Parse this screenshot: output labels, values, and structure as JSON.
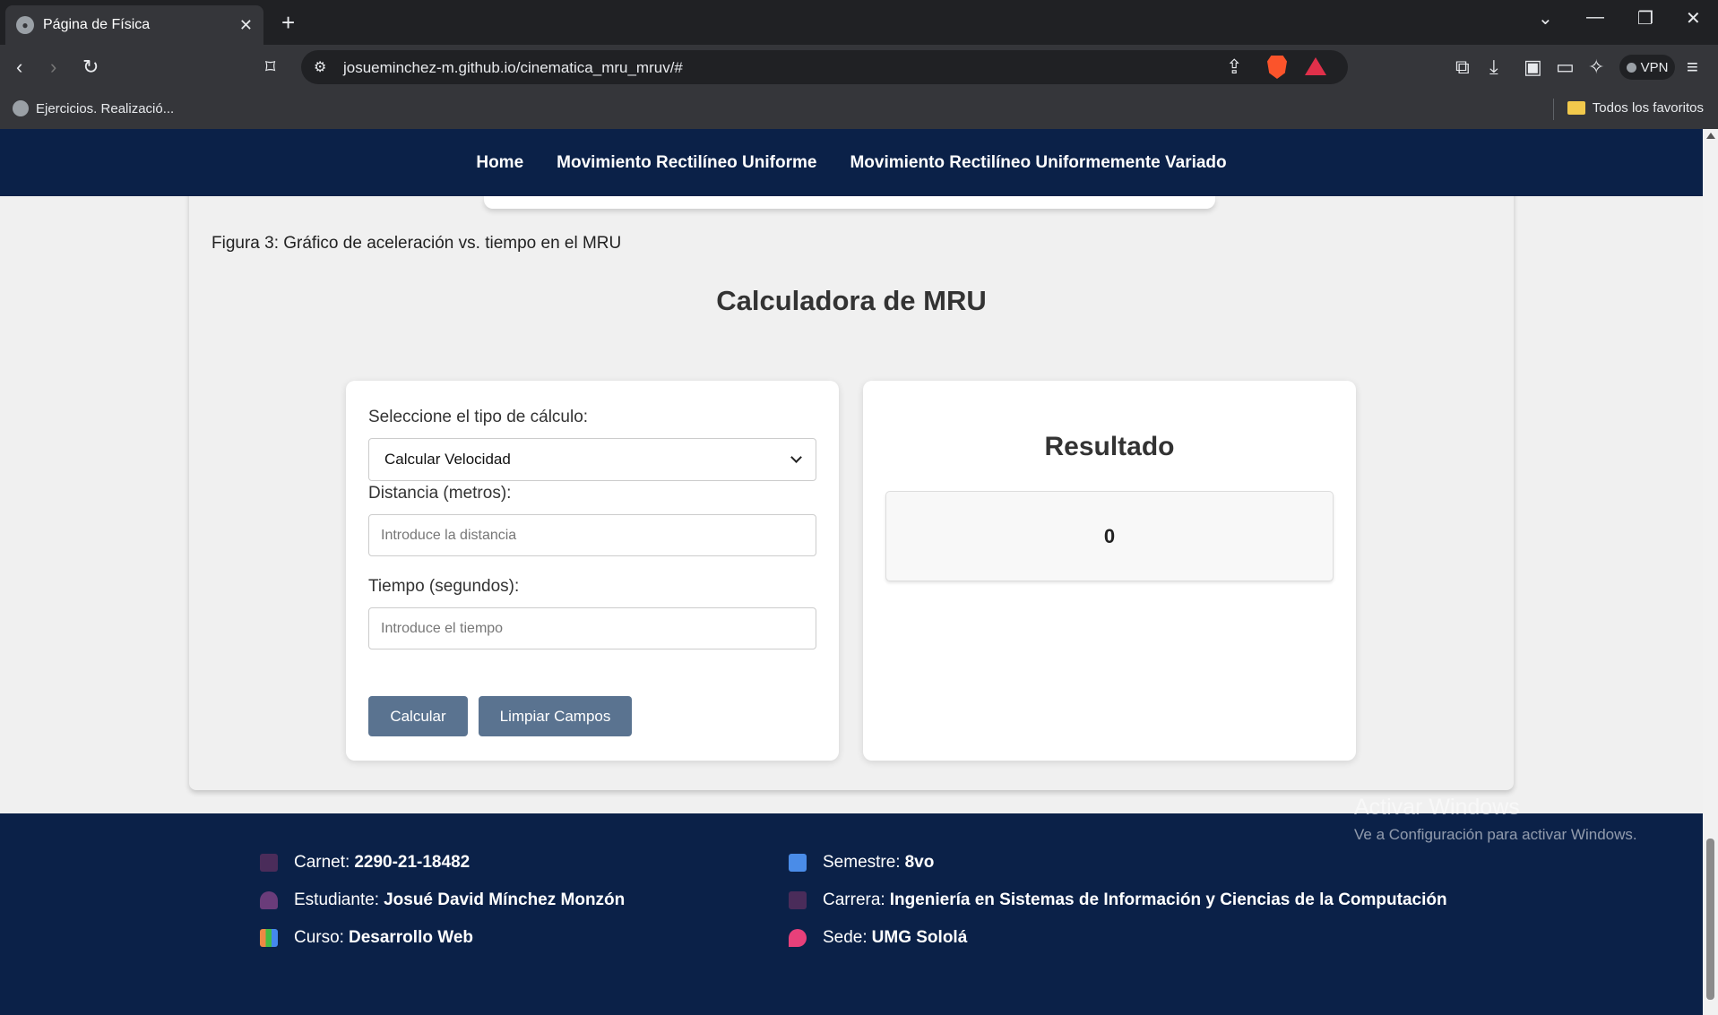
{
  "browser": {
    "tab_title": "Página de Física",
    "url_host": "josueminchez-m.github.io",
    "url_path": "/cinematica_mru_mruv/#",
    "bookmark_left": "Ejercicios. Realizació...",
    "bookmark_right": "Todos los favoritos",
    "vpn_label": "VPN"
  },
  "nav": {
    "items": [
      "Home",
      "Movimiento Rectilíneo Uniforme",
      "Movimiento Rectilíneo Uniformemente Variado"
    ]
  },
  "content": {
    "figure_caption": "Figura 3: Gráfico de aceleración vs. tiempo en el MRU",
    "calc_title": "Calculadora de MRU",
    "select_label": "Seleccione el tipo de cálculo:",
    "select_value": "Calcular Velocidad",
    "distance_label": "Distancia (metros):",
    "distance_placeholder": "Introduce la distancia",
    "time_label": "Tiempo (segundos):",
    "time_placeholder": "Introduce el tiempo",
    "calc_button": "Calcular",
    "clear_button": "Limpiar Campos",
    "result_title": "Resultado",
    "result_value": "0"
  },
  "footer": {
    "carnet_label": "Carnet:",
    "carnet_value": "2290-21-18482",
    "student_label": "Estudiante:",
    "student_value": "Josué David Mínchez Monzón",
    "course_label": "Curso:",
    "course_value": "Desarrollo Web",
    "semester_label": "Semestre:",
    "semester_value": "8vo",
    "career_label": "Carrera:",
    "career_value": "Ingeniería en Sistemas de Información y Ciencias de la Computación",
    "campus_label": "Sede:",
    "campus_value": "UMG Sololá"
  },
  "watermark": {
    "line1": "Activar Windows",
    "line2": "Ve a Configuración para activar Windows."
  },
  "colors": {
    "navy": "#0b2148",
    "button": "#5a7390"
  }
}
